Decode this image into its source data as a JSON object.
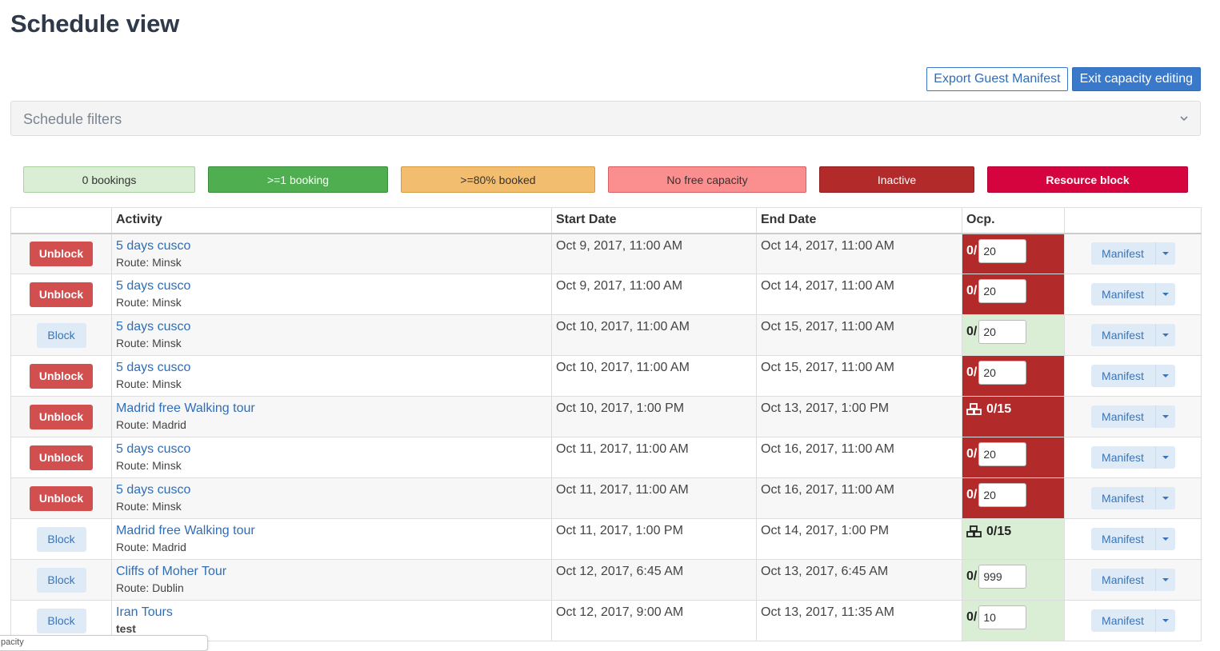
{
  "page": {
    "title": "Schedule view"
  },
  "toolbar": {
    "export_label": "Export Guest Manifest",
    "exit_label": "Exit capacity editing"
  },
  "filters": {
    "label": "Schedule filters"
  },
  "legend": {
    "zero": "0 bookings",
    "one": ">=1 booking",
    "eighty": ">=80% booked",
    "nofree": "No free capacity",
    "inactive": "Inactive",
    "resource": "Resource block"
  },
  "colors": {
    "inactive": "#b32a2a",
    "zero_bookings": "#d9eed4",
    "accent": "#3a78c9",
    "unblock": "#d24f4f"
  },
  "table": {
    "headers": {
      "activity": "Activity",
      "start": "Start Date",
      "end": "End Date",
      "ocp": "Ocp."
    },
    "manifest_label": "Manifest",
    "rows": [
      {
        "action": "Unblock",
        "activity": "5 days cusco",
        "route": "Route: Minsk",
        "start": "Oct 9, 2017, 11:00 AM",
        "end": "Oct 14, 2017, 11:00 AM",
        "ocp_prefix": "0/",
        "capacity": "20",
        "status": "inactive"
      },
      {
        "action": "Unblock",
        "activity": "5 days cusco",
        "route": "Route: Minsk",
        "start": "Oct 9, 2017, 11:00 AM",
        "end": "Oct 14, 2017, 11:00 AM",
        "ocp_prefix": "0/",
        "capacity": "20",
        "status": "inactive"
      },
      {
        "action": "Block",
        "activity": "5 days cusco",
        "route": "Route: Minsk",
        "start": "Oct 10, 2017, 11:00 AM",
        "end": "Oct 15, 2017, 11:00 AM",
        "ocp_prefix": "0/",
        "capacity": "20",
        "status": "zero"
      },
      {
        "action": "Unblock",
        "activity": "5 days cusco",
        "route": "Route: Minsk",
        "start": "Oct 10, 2017, 11:00 AM",
        "end": "Oct 15, 2017, 11:00 AM",
        "ocp_prefix": "0/",
        "capacity": "20",
        "status": "inactive"
      },
      {
        "action": "Unblock",
        "activity": "Madrid free Walking tour",
        "route": "Route: Madrid",
        "start": "Oct 10, 2017, 1:00 PM",
        "end": "Oct 13, 2017, 1:00 PM",
        "resource_ocp": "0/15",
        "status": "inactive"
      },
      {
        "action": "Unblock",
        "activity": "5 days cusco",
        "route": "Route: Minsk",
        "start": "Oct 11, 2017, 11:00 AM",
        "end": "Oct 16, 2017, 11:00 AM",
        "ocp_prefix": "0/",
        "capacity": "20",
        "status": "inactive"
      },
      {
        "action": "Unblock",
        "activity": "5 days cusco",
        "route": "Route: Minsk",
        "start": "Oct 11, 2017, 11:00 AM",
        "end": "Oct 16, 2017, 11:00 AM",
        "ocp_prefix": "0/",
        "capacity": "20",
        "status": "inactive"
      },
      {
        "action": "Block",
        "activity": "Madrid free Walking tour",
        "route": "Route: Madrid",
        "start": "Oct 11, 2017, 1:00 PM",
        "end": "Oct 14, 2017, 1:00 PM",
        "resource_ocp": "0/15",
        "status": "zero"
      },
      {
        "action": "Block",
        "activity": "Cliffs of Moher Tour",
        "route": "Route: Dublin",
        "start": "Oct 12, 2017, 6:45 AM",
        "end": "Oct 13, 2017, 6:45 AM",
        "ocp_prefix": "0/",
        "capacity": "999",
        "status": "zero"
      },
      {
        "action": "Block",
        "activity": "Iran Tours",
        "route": "test",
        "route_bold": true,
        "start": "Oct 12, 2017, 9:00 AM",
        "end": "Oct 13, 2017, 11:35 AM",
        "ocp_prefix": "0/",
        "capacity": "10",
        "status": "zero"
      }
    ]
  },
  "tooltip": {
    "text": "pacity"
  }
}
